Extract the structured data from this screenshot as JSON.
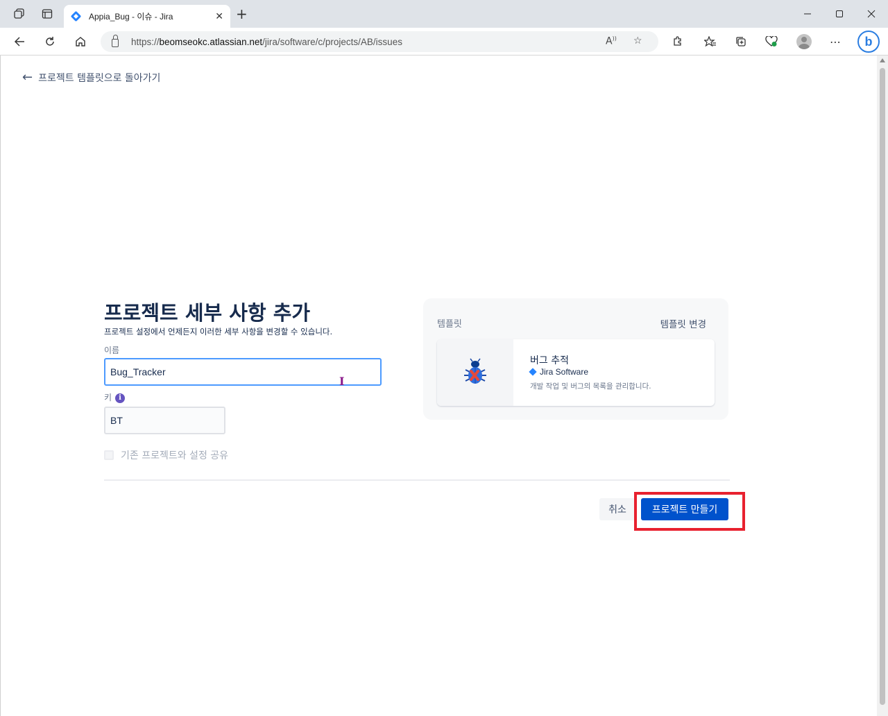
{
  "browser": {
    "tab_title": "Appia_Bug - 이슈 - Jira",
    "url_prefix": "https://",
    "url_host": "beomseokc.atlassian.net",
    "url_path": "/jira/software/c/projects/AB/issues"
  },
  "page": {
    "back_link": "프로젝트 템플릿으로 돌아가기",
    "title": "프로젝트 세부 사항 추가",
    "subtitle": "프로젝트 설정에서 언제든지 이러한 세부 사항을 변경할 수 있습니다.",
    "name_label": "이름",
    "name_value": "Bug_Tracker",
    "key_label": "키",
    "key_value": "BT",
    "share_settings_label": "기존 프로젝트와 설정 공유",
    "cancel_label": "취소",
    "create_label": "프로젝트 만들기"
  },
  "template": {
    "heading": "템플릿",
    "change_label": "템플릿 변경",
    "name": "버그 추적",
    "product": "Jira Software",
    "description": "개발 작업 및 버그의 목록을 관리합니다."
  },
  "colors": {
    "primary_button": "#0052cc",
    "focus_border": "#4c9aff",
    "highlight": "#e8212f",
    "info_icon": "#6554c0"
  }
}
